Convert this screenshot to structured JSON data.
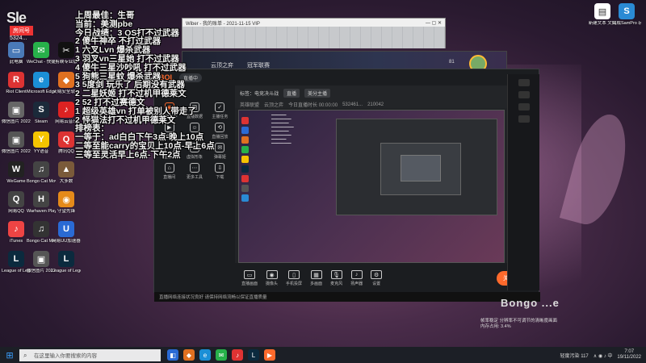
{
  "overlay": {
    "lines": [
      "上周最佳：生哥",
      "当前：美测pbe",
      "今日战绩：3 QS打不过武器",
      "2 傻牛神卒 不打过武器",
      "1 六叉Lvn 爆杀武器",
      "3 羽叉vn三星她 打不过武器",
      "4 傻牛三星沙吵吼 打不过武器",
      "5 狗熊三星蚊 爆杀武器",
      "3 5度剑 玩乐了 后期没有武器",
      "2 二星妖姬 打不过机甲德莱文",
      "2 52 打不过赛德文",
      "1 超级英雄vn 打单被别人带走了",
      "2 怪猫法打不过机甲德莱文",
      "排榜表：",
      "一等于：ad白白下午3点-晚上10点",
      "二等至能carry的宝贝上10点-早上6点",
      "三等至灵活早上6点-下午2点"
    ]
  },
  "stream_logo": "Sle",
  "room_tag": "房间号",
  "room_num": "5324...",
  "desktop_icons": [
    {
      "label": "此电脑",
      "color": "#4a7ab8",
      "glyph": "▭"
    },
    {
      "label": "WeChat - 快捷方式",
      "color": "#27b14a",
      "glyph": "✉"
    },
    {
      "label": "剪映专业版",
      "color": "#111",
      "glyph": "✂"
    },
    {
      "label": "Riot Client",
      "color": "#d33",
      "glyph": "R"
    },
    {
      "label": "Microsoft Edge",
      "color": "#1b8fd6",
      "glyph": "e"
    },
    {
      "label": "火绒安全软件",
      "color": "#e07020",
      "glyph": "◆"
    },
    {
      "label": "微信图片 2022...",
      "color": "#666",
      "glyph": "▣"
    },
    {
      "label": "Steam",
      "color": "#1b2a3a",
      "glyph": "S"
    },
    {
      "label": "网易云音乐",
      "color": "#d22",
      "glyph": "♪"
    },
    {
      "label": "微信图片 20221...",
      "color": "#555",
      "glyph": "▣"
    },
    {
      "label": "YY语音",
      "color": "#f5c400",
      "glyph": "Y"
    },
    {
      "label": "腾讯QQ",
      "color": "#d33",
      "glyph": "Q"
    },
    {
      "label": "WeGame",
      "color": "#222",
      "glyph": "W"
    },
    {
      "label": "Bongo Cat Mover - 快...",
      "color": "#444",
      "glyph": "♫"
    },
    {
      "label": "大多数",
      "color": "#7a5a3a",
      "glyph": "▲"
    },
    {
      "label": "网易QQ",
      "color": "#444",
      "glyph": "Q"
    },
    {
      "label": "Warhaven Playtest",
      "color": "#444",
      "glyph": "H"
    },
    {
      "label": "守望先锋",
      "color": "#e58a1a",
      "glyph": "◉"
    },
    {
      "label": "iTunes",
      "color": "#e44",
      "glyph": "♪"
    },
    {
      "label": "Bongo Cat Mover - 快...",
      "color": "#333",
      "glyph": "♫"
    },
    {
      "label": "网易UU加速器",
      "color": "#2a6ad4",
      "glyph": "U"
    },
    {
      "label": "League of Legends",
      "color": "#0b2a3e",
      "glyph": "L"
    },
    {
      "label": "微信图片 2022061...",
      "color": "#555",
      "glyph": "▣"
    },
    {
      "label": "League of Legends...",
      "color": "#0b2a3e",
      "glyph": "L"
    }
  ],
  "right_icons": [
    {
      "label": "新建文本 文档",
      "color": "#fff",
      "glyph": "▤"
    },
    {
      "label": "完成SamPro 玩家",
      "color": "#2a8ad4",
      "glyph": "S"
    }
  ],
  "back_window": {
    "title": "Wiber - 我的账单 - 2021-11-15 VIP"
  },
  "game_window": {
    "t1": "云顶之弈",
    "t2": "冠军联赛",
    "badge": "81"
  },
  "obs": {
    "logo": "BOL",
    "title_pill": "直播中",
    "ctrl": "≡  —  ▢  ✕",
    "info_label": "标签：电竞决斗战",
    "info_tag": "直播",
    "info_game": "美分主播",
    "row2": [
      "英雄联盟",
      "云顶之弈",
      "今日直播时长 00:00:00",
      "532461...",
      "210042"
    ],
    "section_title": "直播工具",
    "tools": [
      {
        "label": "直播助手",
        "hot": true,
        "glyph": "◉"
      },
      {
        "label": "直播数据",
        "hot": false,
        "glyph": "▦"
      },
      {
        "label": "主播任务",
        "hot": false,
        "glyph": "✓"
      },
      {
        "label": "视频直播",
        "hot": false,
        "glyph": "▶"
      },
      {
        "label": "多人连麦",
        "hot": false,
        "glyph": "☺"
      },
      {
        "label": "直播回放",
        "hot": false,
        "glyph": "⟲"
      },
      {
        "label": "直播团",
        "hot": false,
        "glyph": "♖"
      },
      {
        "label": "虚拟形象",
        "hot": false,
        "glyph": "☻"
      },
      {
        "label": "弹幕姬",
        "hot": false,
        "glyph": "✉"
      },
      {
        "label": "直播间",
        "hot": false,
        "glyph": "⌂"
      },
      {
        "label": "更多工具",
        "hot": false,
        "glyph": "⋯"
      },
      {
        "label": "下载",
        "hot": false,
        "glyph": "⇩"
      }
    ],
    "bottom_buttons": [
      {
        "label": "直播画面",
        "glyph": "▭"
      },
      {
        "label": "摄像头",
        "glyph": "◉"
      },
      {
        "label": "手机投屏",
        "glyph": "▯"
      },
      {
        "label": "多画面",
        "glyph": "▦"
      },
      {
        "label": "麦克风",
        "glyph": "🎙"
      },
      {
        "label": "扬声器",
        "glyph": "♪"
      },
      {
        "label": "设置",
        "glyph": "⚙"
      }
    ],
    "live_button": "关闭直播",
    "status": "直播网络连接状况良好  请保持网络流畅以保证直播质量"
  },
  "bongo_text": "Bongo ...e",
  "fps_lines": [
    "帧率稳定  分辨率不可调节的清晰度画面",
    "内存占用: 3.4%"
  ],
  "taskbar": {
    "search_placeholder": "在这里输入你要搜索的内容",
    "apps": [
      {
        "color": "#2a6ad4",
        "glyph": "◧"
      },
      {
        "color": "#e07020",
        "glyph": "◆"
      },
      {
        "color": "#1b8fd6",
        "glyph": "e"
      },
      {
        "color": "#27b14a",
        "glyph": "✉"
      },
      {
        "color": "#d33",
        "glyph": "♪"
      },
      {
        "color": "#0b2a3e",
        "glyph": "L"
      },
      {
        "color": "#ff6a2c",
        "glyph": "▶"
      }
    ],
    "weather": "轻度污染 117",
    "tray_icons": "∧  ◉  ♪  中",
    "time": "7:07",
    "date": "19/11/2022"
  }
}
